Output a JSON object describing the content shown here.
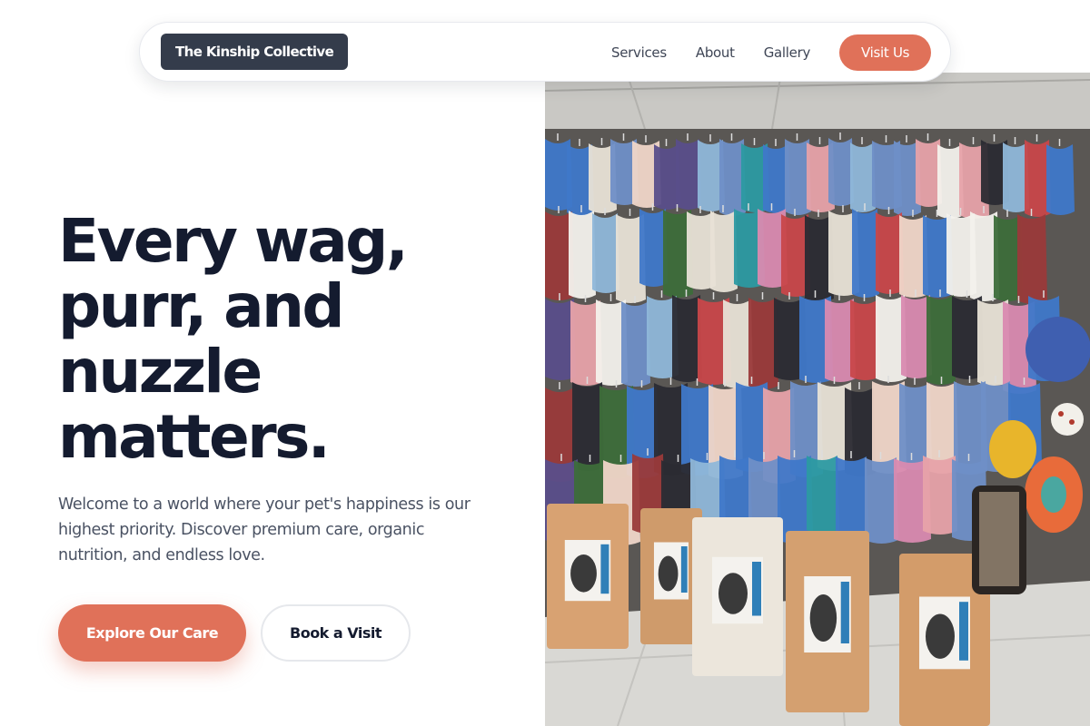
{
  "nav": {
    "brand": "The Kinship Collective",
    "links": [
      "Services",
      "About",
      "Gallery"
    ],
    "cta": "Visit Us"
  },
  "hero": {
    "headline_lines": [
      "Every wag,",
      "purr, and",
      "nuzzle",
      "matters."
    ],
    "subcopy_lines": [
      "Welcome to a world where your pet's happiness is our",
      "highest priority. Discover premium care, organic",
      "nutrition, and endless love."
    ],
    "primary_button": "Explore Our Care",
    "secondary_button": "Book a Visit"
  },
  "colors": {
    "accent": "#e07159",
    "brand_badge": "#343c4b",
    "heading": "#141b2f",
    "body_text": "#4a5263"
  },
  "image": {
    "subject": "pet store wall of hanging pet clothing with bags of cat food on the floor",
    "alt": ""
  }
}
